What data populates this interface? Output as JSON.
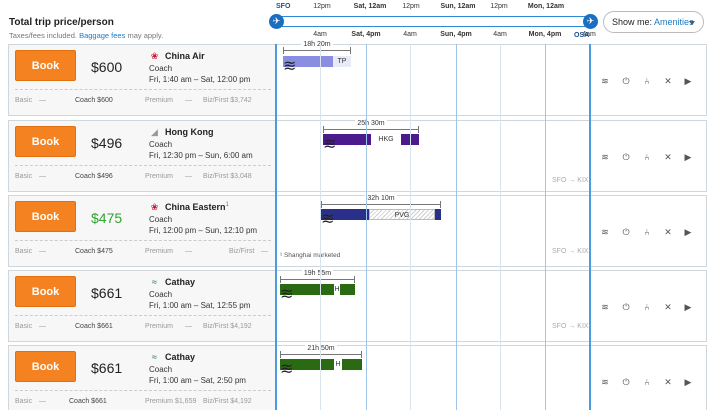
{
  "header": {
    "title": "Total trip price/person",
    "subtitle_prefix": "Taxes/fees included.",
    "subtitle_link": "Baggage fees",
    "subtitle_suffix": "may apply.",
    "origin": "SFO",
    "destination": "OSA",
    "top_ticks": [
      {
        "label": "12pm",
        "bold": false
      },
      {
        "label": "Sat, 12am",
        "bold": true
      },
      {
        "label": "12pm",
        "bold": false
      },
      {
        "label": "Sun, 12am",
        "bold": true
      },
      {
        "label": "12pm",
        "bold": false
      },
      {
        "label": "Mon, 12am",
        "bold": true
      }
    ],
    "bottom_ticks": [
      {
        "label": "4am",
        "bold": false
      },
      {
        "label": "Sat, 4pm",
        "bold": true
      },
      {
        "label": "4am",
        "bold": false
      },
      {
        "label": "Sun, 4pm",
        "bold": true
      },
      {
        "label": "4am",
        "bold": false
      },
      {
        "label": "Mon, 4pm",
        "bold": true
      },
      {
        "label": "4am",
        "bold": false
      }
    ],
    "show_me_label": "Show me:",
    "show_me_value": "Amenities"
  },
  "book_label": "Book",
  "flights": [
    {
      "price": "$600",
      "price_green": false,
      "airline": "China Air",
      "airline_sup": "",
      "logo_icon": "plum-blossom-icon",
      "logo_color": "#c8102e",
      "cabin": "Coach",
      "times": "Fri, 1:40 am – Sat, 12:00 pm",
      "fares": {
        "basic": "Basic",
        "basic_val": "—",
        "coach": "Coach $600",
        "premium": "Premium",
        "premium_val": "—",
        "biz": "Biz/First $3,742"
      },
      "duration": "18h 20m",
      "segment_label": "TP",
      "bar_color": "#8a8ee0",
      "route": "",
      "note": ""
    },
    {
      "price": "$496",
      "price_green": false,
      "airline": "Hong Kong",
      "airline_sup": "",
      "logo_icon": "tail-fin-icon",
      "logo_color": "#999999",
      "cabin": "Coach",
      "times": "Fri, 12:30 pm – Sun, 6:00 am",
      "fares": {
        "basic": "Basic",
        "basic_val": "—",
        "coach": "Coach $496",
        "premium": "Premium",
        "premium_val": "—",
        "biz": "Biz/First $3,048"
      },
      "duration": "25h 30m",
      "segment_label": "HKG",
      "bar_color": "#4b1a8c",
      "route": "SFO → KIX",
      "note": ""
    },
    {
      "price": "$475",
      "price_green": true,
      "airline": "China Eastern",
      "airline_sup": "1",
      "logo_icon": "china-eastern-logo-icon",
      "logo_color": "#c8102e",
      "cabin": "Coach",
      "times": "Fri, 12:00 pm – Sun, 12:10 pm",
      "fares": {
        "basic": "Basic",
        "basic_val": "—",
        "coach": "Coach $475",
        "premium": "Premium",
        "premium_val": "—",
        "biz": "Biz/First",
        "biz_val": "—"
      },
      "duration": "32h 10m",
      "segment_label": "PVG",
      "bar_color": "#2a2f8a",
      "route": "SFO → KIX",
      "note": "¹ Shanghai marketed"
    },
    {
      "price": "$661",
      "price_green": false,
      "airline": "Cathay",
      "airline_sup": "",
      "logo_icon": "cathay-wing-icon",
      "logo_color": "#1f6e5e",
      "cabin": "Coach",
      "times": "Fri, 1:00 am – Sat, 12:55 pm",
      "fares": {
        "basic": "Basic",
        "basic_val": "—",
        "coach": "Coach $661",
        "premium": "Premium",
        "premium_val": "—",
        "biz": "Biz/First $4,192"
      },
      "duration": "19h 55m",
      "segment_label": "H",
      "bar_color": "#2a6a12",
      "route": "SFO → KIX",
      "note": ""
    },
    {
      "price": "$661",
      "price_green": false,
      "airline": "Cathay",
      "airline_sup": "",
      "logo_icon": "cathay-wing-icon",
      "logo_color": "#1f6e5e",
      "cabin": "Coach",
      "times": "Fri, 1:00 am – Sat, 2:50 pm",
      "fares": {
        "basic": "Basic",
        "basic_val": "—",
        "coach": "Coach $661",
        "premium": "Premium $1,659",
        "premium_val": "",
        "biz": "Biz/First $4,192"
      },
      "duration": "21h 50m",
      "segment_label": "H",
      "bar_color": "#2a6a12",
      "route": "",
      "note": ""
    }
  ],
  "amenities": [
    {
      "name": "wifi",
      "icon": "wifi-icon",
      "glyph": "≋"
    },
    {
      "name": "power",
      "icon": "power-plug-icon",
      "glyph": "⏻"
    },
    {
      "name": "seat",
      "icon": "seat-icon",
      "glyph": "⑃"
    },
    {
      "name": "meal",
      "icon": "no-meal-icon",
      "glyph": "✕"
    },
    {
      "name": "entertainment",
      "icon": "video-play-icon",
      "glyph": "▶"
    }
  ]
}
